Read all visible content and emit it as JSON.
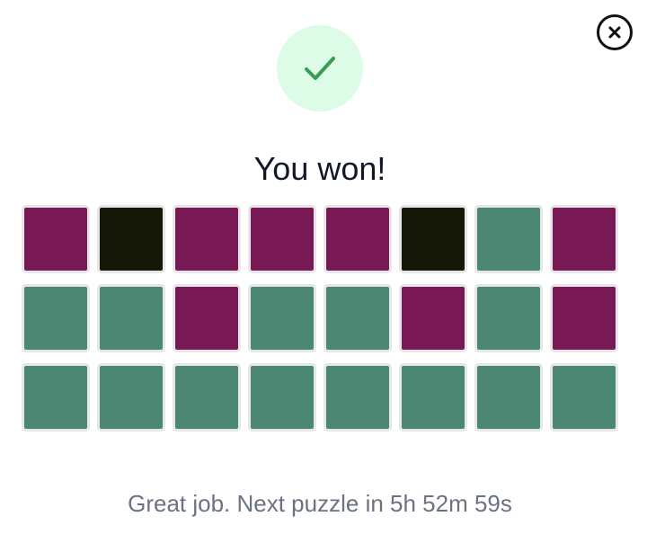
{
  "colors": {
    "purple": "#781955",
    "black": "#161807",
    "green": "#4c8773",
    "success_bg": "#dcfce7",
    "success_check": "#3a9a58"
  },
  "icons": {
    "close": "close-icon",
    "success": "check-icon"
  },
  "result": {
    "title": "You won!",
    "message": "Great job. Next puzzle in 5h 52m 59s"
  },
  "grid": {
    "rows": [
      [
        "purple",
        "black",
        "purple",
        "purple",
        "purple",
        "black",
        "green",
        "purple"
      ],
      [
        "green",
        "green",
        "purple",
        "green",
        "green",
        "purple",
        "green",
        "purple"
      ],
      [
        "green",
        "green",
        "green",
        "green",
        "green",
        "green",
        "green",
        "green"
      ]
    ]
  }
}
